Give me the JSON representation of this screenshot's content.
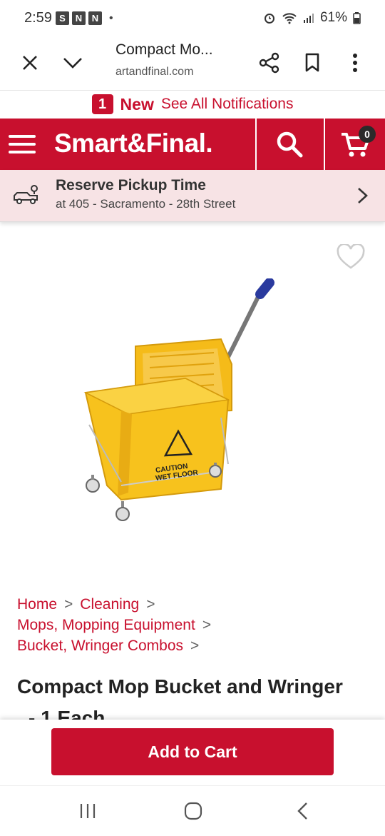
{
  "status": {
    "time": "2:59",
    "battery": "61%",
    "notif_icons": [
      "S",
      "N",
      "N"
    ]
  },
  "browser": {
    "title": "Compact Mo...",
    "url": "artandfinal.com"
  },
  "notification": {
    "count": "1",
    "new_label": "New",
    "see_all": "See All Notifications"
  },
  "header": {
    "logo": "Smart&Final.",
    "cart_count": "0"
  },
  "pickup": {
    "title": "Reserve Pickup Time",
    "location": "at 405 - Sacramento - 28th Street"
  },
  "breadcrumb": {
    "items": [
      "Home",
      "Cleaning",
      "Mops, Mopping Equipment",
      "Bucket, Wringer Combos"
    ],
    "separator": ">"
  },
  "product": {
    "title_line1": "Compact Mop Bucket and Wringer",
    "title_line2": "- 1 Each"
  },
  "cart": {
    "add_label": "Add to Cart"
  },
  "image": {
    "sign_text_1": "CAUTION",
    "sign_text_2": "WET FLOOR",
    "bucket_color": "#f7c21d"
  },
  "colors": {
    "brand": "#c8102e",
    "pickup_bg": "#f7e3e5"
  }
}
